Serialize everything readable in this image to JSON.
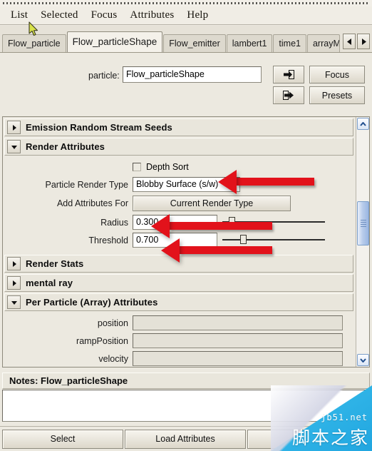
{
  "window": {
    "grip": "tearoff-grip"
  },
  "menubar": {
    "items": [
      {
        "label": "List"
      },
      {
        "label": "Selected"
      },
      {
        "label": "Focus"
      },
      {
        "label": "Attributes"
      },
      {
        "label": "Help"
      }
    ]
  },
  "tabs": {
    "items": [
      {
        "label": "Flow_particle",
        "active": false
      },
      {
        "label": "Flow_particleShape",
        "active": true
      },
      {
        "label": "Flow_emitter",
        "active": false
      },
      {
        "label": "lambert1",
        "active": false
      },
      {
        "label": "time1",
        "active": false
      },
      {
        "label": "arrayMa",
        "active": false,
        "clipped": true
      }
    ],
    "nav_prev": "prev-tab-arrow",
    "nav_next": "next-tab-arrow"
  },
  "node_row": {
    "label": "particle:",
    "value": "Flow_particleShape",
    "placeholder": "",
    "btn_in_icon": "arrow-into-box-icon",
    "btn_out_icon": "arrow-out-of-box-icon",
    "focus_label": "Focus",
    "presets_label": "Presets"
  },
  "sections": [
    {
      "title": "Emission Random Stream Seeds",
      "expanded": false
    },
    {
      "title": "Render Attributes",
      "expanded": true
    },
    {
      "title": "Render Stats",
      "expanded": false
    },
    {
      "title": "mental ray",
      "expanded": false
    },
    {
      "title": "Per Particle (Array) Attributes",
      "expanded": true
    }
  ],
  "render_attributes": {
    "depth_sort": {
      "label": "Depth Sort",
      "checked": false
    },
    "particle_render_type": {
      "label": "Particle Render Type",
      "value": "Blobby Surface (s/w)"
    },
    "add_attributes_for": {
      "label": "Add Attributes For",
      "button": "Current Render Type"
    },
    "radius": {
      "label": "Radius",
      "value": "0.300",
      "handle_pct": 10
    },
    "threshold": {
      "label": "Threshold",
      "value": "0.700",
      "handle_pct": 22
    }
  },
  "per_particle": {
    "rows": [
      {
        "label": "position",
        "value": ""
      },
      {
        "label": "rampPosition",
        "value": ""
      },
      {
        "label": "velocity",
        "value": ""
      }
    ]
  },
  "scrollbar": {
    "up_icon": "chevron-up-icon",
    "down_icon": "chevron-down-icon",
    "thumb": "scroll-thumb"
  },
  "notes": {
    "header": "Notes: Flow_particleShape",
    "text": ""
  },
  "bottom_buttons": [
    {
      "label": "Select"
    },
    {
      "label": "Load Attributes"
    },
    {
      "label": ""
    }
  ],
  "annotations": {
    "arrow_render_type": "red-arrow-pointing-to-particle-render-type",
    "arrow_radius": "red-arrow-pointing-to-radius",
    "arrow_threshold": "red-arrow-pointing-to-threshold"
  },
  "watermark": {
    "site": "jb51.net",
    "name": "脚本之家"
  },
  "colors": {
    "panel_bg": "#ece9e0",
    "field_bg": "#ffffff",
    "accent_red": "#e2121b",
    "scroll_blue": "#9ab6e2",
    "watermark_blue": "#21a6e0"
  }
}
